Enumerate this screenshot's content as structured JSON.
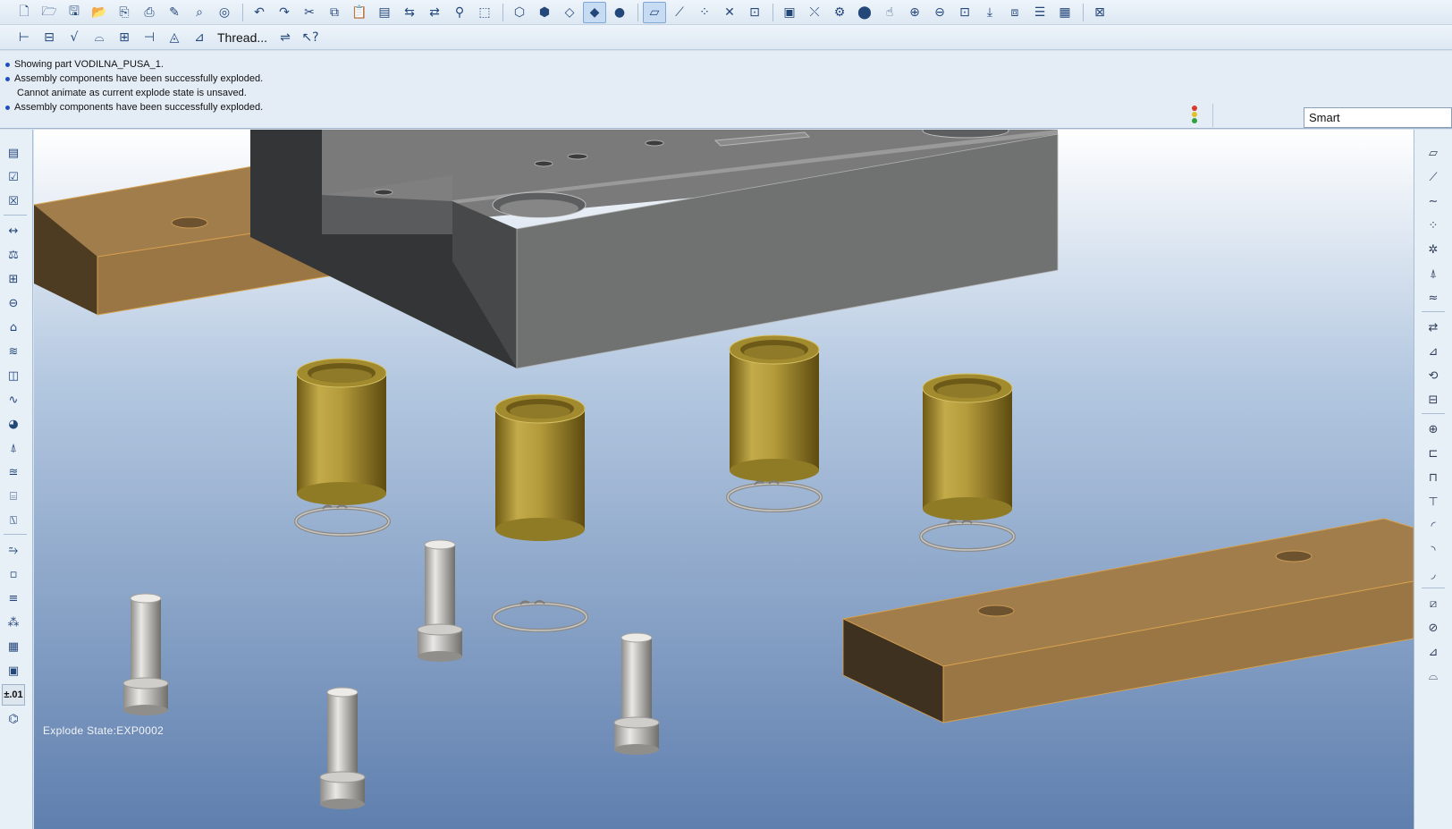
{
  "toolbar_top": {
    "group_file": [
      "new-icon",
      "open-icon",
      "save-icon",
      "open-folder-icon",
      "save-copy-icon",
      "print-icon",
      "edit-icon",
      "find-icon",
      "cad-icon"
    ],
    "group_edit": [
      "undo-icon",
      "redo-icon",
      "cut-icon",
      "copy-icon",
      "paste-icon",
      "paste-special-icon",
      "regenerate-icon",
      "regen-manager-icon",
      "binoculars-icon",
      "select-box-icon"
    ],
    "group_view": [
      "wireframe-icon",
      "hidden-line-icon",
      "no-hidden-icon",
      "shading-icon",
      "enhanced-realism-icon"
    ],
    "group_datum": [
      "datum-planes-icon",
      "datum-axes-icon",
      "datum-points-icon",
      "datum-csys-icon",
      "annotation-display-icon"
    ],
    "group_orient": [
      "saved-views-icon",
      "pan-spin-icon",
      "appearance-icon",
      "appearance-gallery-icon",
      "orient-icon",
      "zoom-in-icon",
      "zoom-out-icon",
      "refit-icon",
      "repaint-icon",
      "layer-icon",
      "layers-icon",
      "model-tree-icon",
      "context-help-icon"
    ]
  },
  "toolbar_second": {
    "thread_label": "Thread...",
    "items": [
      "dimension-icon",
      "note-icon",
      "surface-finish-icon",
      "geometric-tolerance-icon",
      "datum-target-icon",
      "cosmetic-sketch-icon",
      "symbol-icon",
      "cosmetic-thread-icon",
      "align-icon",
      "whats-this-icon"
    ]
  },
  "messages": [
    {
      "text": "Showing part VODILNA_PUSA_1.",
      "bullet": true
    },
    {
      "text": "Assembly components have been successfully exploded.",
      "bullet": true
    },
    {
      "text": "Cannot animate as current explode state is unsaved.",
      "bullet": false
    },
    {
      "text": "Assembly components have been successfully exploded.",
      "bullet": true
    }
  ],
  "filter": {
    "value": "Smart"
  },
  "left_toolbar": [
    "view-manager-icon",
    "check-icon",
    "close-icon",
    "measure-icon",
    "mass-props-icon",
    "section-icon",
    "section-props-icon",
    "analysis-icon",
    "curvature-icon",
    "draft-icon",
    "graph-icon",
    "shade-map-icon",
    "dihedral-icon",
    "offset-icon",
    "reflection-icon",
    "saved-analysis-icon",
    "hide-analysis-icon",
    "plus-minus-icon",
    "component-icon",
    "info-icon",
    "parameters-icon",
    "relations-icon",
    "family-table-icon",
    "tolerance-toggle",
    "pipe-icon"
  ],
  "tolerance_label": "±.01",
  "right_toolbar": [
    "plane-icon",
    "line-icon",
    "curve-icon",
    "point-icon",
    "point-offset-icon",
    "point-field-icon",
    "analysis-feature-icon",
    "copy-geom-icon",
    "extrude-icon",
    "revolve-icon",
    "sweep-icon",
    "hole-icon",
    "shell-icon",
    "rib-icon",
    "draft-feature-icon",
    "round-icon",
    "chamfer-icon",
    "pattern-icon",
    "mirror-icon",
    "trim-icon",
    "merge-icon",
    "offset-feature-icon"
  ],
  "explode_state": "Explode State:EXP0002",
  "colors": {
    "wood": "#a17d4b",
    "steel": "#7a7a7a",
    "brass": "#b09a3e",
    "pin": "#d8d6d2"
  }
}
